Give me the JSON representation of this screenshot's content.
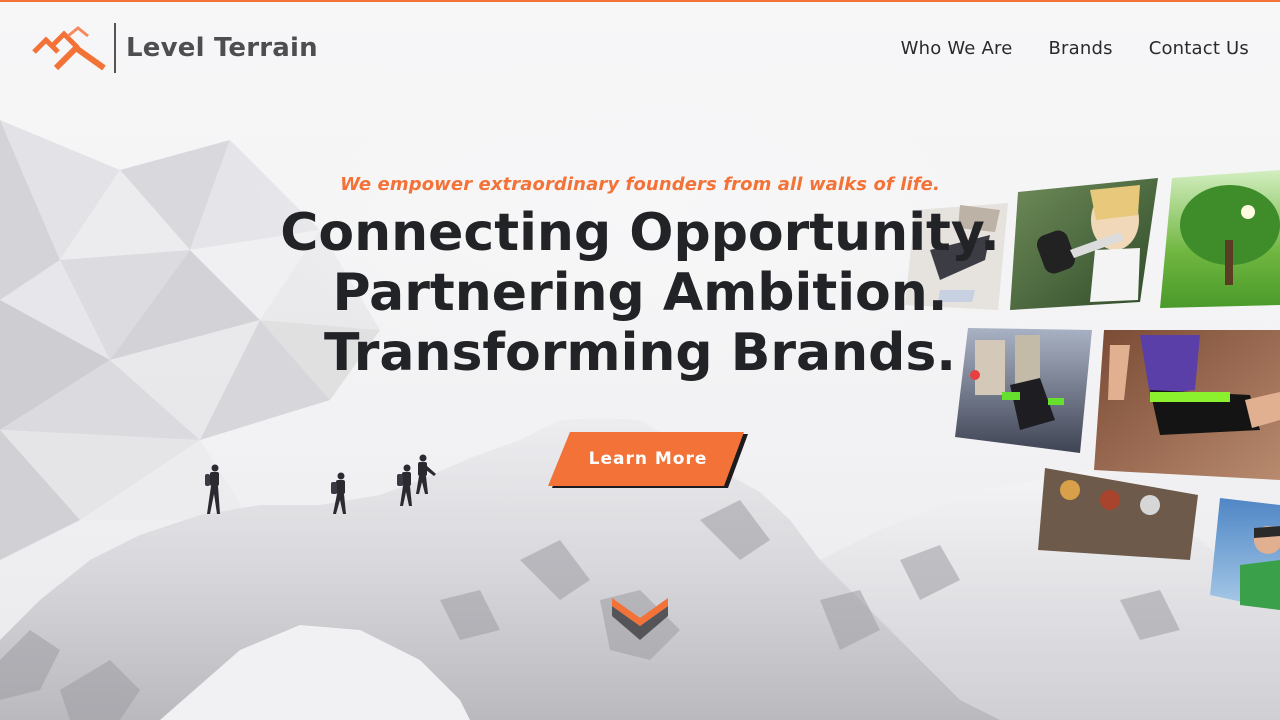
{
  "colors": {
    "accent": "#f37237",
    "headline": "#222327",
    "logo_text": "#4e4e50",
    "nav_text": "#2a2a2e"
  },
  "header": {
    "logo_text": "Level Terrain",
    "nav": [
      {
        "label": "Who We Are"
      },
      {
        "label": "Brands"
      },
      {
        "label": "Contact Us"
      }
    ]
  },
  "hero": {
    "tagline": "We empower extraordinary founders from all walks of life.",
    "headline_lines": [
      "Connecting Opportunity.",
      "Partnering Ambition.",
      "Transforming Brands."
    ],
    "cta_label": "Learn More"
  },
  "icons": {
    "logo": "mountain-logo-icon",
    "scroll": "chevron-down-icon"
  }
}
